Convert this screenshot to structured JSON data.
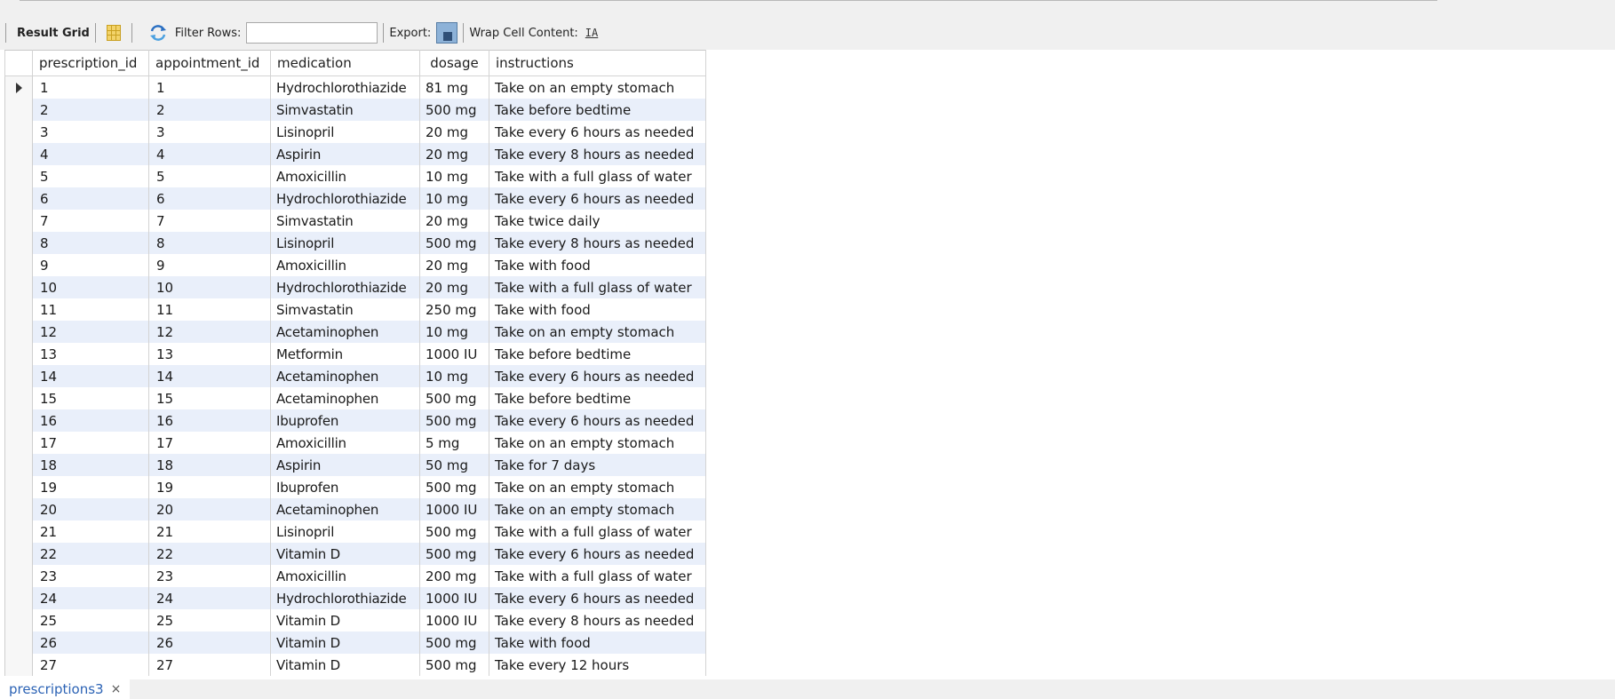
{
  "toolbar": {
    "result_grid_label": "Result Grid",
    "filter_rows_label": "Filter Rows:",
    "filter_value": "",
    "export_label": "Export:",
    "wrap_label": "Wrap Cell Content:",
    "wrap_icon_glyph": "IA"
  },
  "grid": {
    "columns": [
      "prescription_id",
      "appointment_id",
      "medication",
      "dosage",
      "instructions"
    ],
    "rows": [
      [
        "1",
        "1",
        "Hydrochlorothiazide",
        "81 mg",
        "Take on an empty stomach"
      ],
      [
        "2",
        "2",
        "Simvastatin",
        "500 mg",
        "Take before bedtime"
      ],
      [
        "3",
        "3",
        "Lisinopril",
        "20 mg",
        "Take every 6 hours as needed"
      ],
      [
        "4",
        "4",
        "Aspirin",
        "20 mg",
        "Take every 8 hours as needed"
      ],
      [
        "5",
        "5",
        "Amoxicillin",
        "10 mg",
        "Take with a full glass of water"
      ],
      [
        "6",
        "6",
        "Hydrochlorothiazide",
        "10 mg",
        "Take every 6 hours as needed"
      ],
      [
        "7",
        "7",
        "Simvastatin",
        "20 mg",
        "Take twice daily"
      ],
      [
        "8",
        "8",
        "Lisinopril",
        "500 mg",
        "Take every 8 hours as needed"
      ],
      [
        "9",
        "9",
        "Amoxicillin",
        "20 mg",
        "Take with food"
      ],
      [
        "10",
        "10",
        "Hydrochlorothiazide",
        "20 mg",
        "Take with a full glass of water"
      ],
      [
        "11",
        "11",
        "Simvastatin",
        "250 mg",
        "Take with food"
      ],
      [
        "12",
        "12",
        "Acetaminophen",
        "10 mg",
        "Take on an empty stomach"
      ],
      [
        "13",
        "13",
        "Metformin",
        "1000 IU",
        "Take before bedtime"
      ],
      [
        "14",
        "14",
        "Acetaminophen",
        "10 mg",
        "Take every 6 hours as needed"
      ],
      [
        "15",
        "15",
        "Acetaminophen",
        "500 mg",
        "Take before bedtime"
      ],
      [
        "16",
        "16",
        "Ibuprofen",
        "500 mg",
        "Take every 6 hours as needed"
      ],
      [
        "17",
        "17",
        "Amoxicillin",
        "5 mg",
        "Take on an empty stomach"
      ],
      [
        "18",
        "18",
        "Aspirin",
        "50 mg",
        "Take for 7 days"
      ],
      [
        "19",
        "19",
        "Ibuprofen",
        "500 mg",
        "Take on an empty stomach"
      ],
      [
        "20",
        "20",
        "Acetaminophen",
        "1000 IU",
        "Take on an empty stomach"
      ],
      [
        "21",
        "21",
        "Lisinopril",
        "500 mg",
        "Take with a full glass of water"
      ],
      [
        "22",
        "22",
        "Vitamin D",
        "500 mg",
        "Take every 6 hours as needed"
      ],
      [
        "23",
        "23",
        "Amoxicillin",
        "200 mg",
        "Take with a full glass of water"
      ],
      [
        "24",
        "24",
        "Hydrochlorothiazide",
        "1000 IU",
        "Take every 6 hours as needed"
      ],
      [
        "25",
        "25",
        "Vitamin D",
        "1000 IU",
        "Take every 8 hours as needed"
      ],
      [
        "26",
        "26",
        "Vitamin D",
        "500 mg",
        "Take with food"
      ],
      [
        "27",
        "27",
        "Vitamin D",
        "500 mg",
        "Take every 12 hours"
      ]
    ]
  },
  "tabs": [
    {
      "label": "prescriptions3",
      "close_glyph": "×"
    }
  ],
  "colors": {
    "alt_row": "#e9effa",
    "tab_text": "#2c63b5"
  }
}
